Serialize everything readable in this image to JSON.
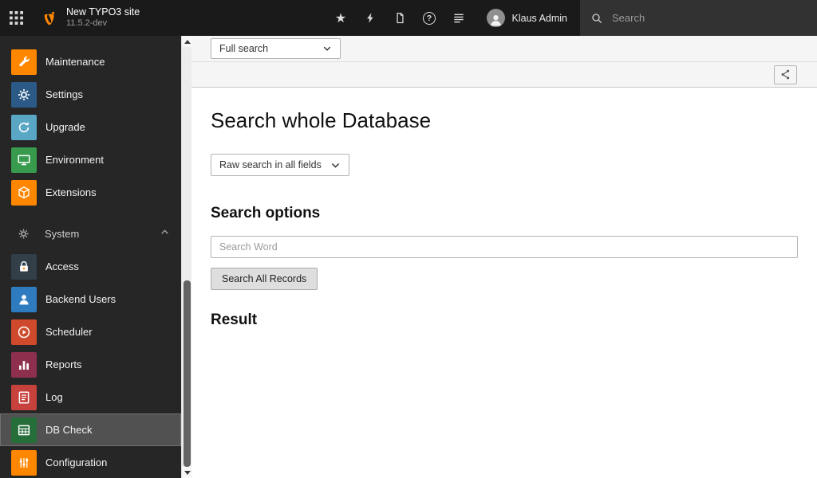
{
  "topbar": {
    "site_title": "New TYPO3 site",
    "site_version": "11.5.2-dev",
    "user_name": "Klaus Admin",
    "search_placeholder": "Search",
    "help_glyph": "?",
    "star_glyph": "★"
  },
  "sidebar": {
    "system_label": "System",
    "items": [
      {
        "label": "Maintenance",
        "icon": "wrench-icon",
        "color": "#ff8700"
      },
      {
        "label": "Settings",
        "icon": "gear-icon",
        "color": "#2c5a87"
      },
      {
        "label": "Upgrade",
        "icon": "refresh-icon",
        "color": "#59a6c5"
      },
      {
        "label": "Environment",
        "icon": "monitor-icon",
        "color": "#389a4c"
      },
      {
        "label": "Extensions",
        "icon": "cube-icon",
        "color": "#ff8700"
      },
      {
        "label": "Access",
        "icon": "lock-icon",
        "color": "#323e48"
      },
      {
        "label": "Backend Users",
        "icon": "user-icon",
        "color": "#2e7bc0"
      },
      {
        "label": "Scheduler",
        "icon": "play-circle-icon",
        "color": "#cf4a2c"
      },
      {
        "label": "Reports",
        "icon": "chart-icon",
        "color": "#8e2f4e"
      },
      {
        "label": "Log",
        "icon": "log-icon",
        "color": "#c8423d"
      },
      {
        "label": "DB Check",
        "icon": "table-icon",
        "color": "#256d39"
      },
      {
        "label": "Configuration",
        "icon": "sliders-icon",
        "color": "#ff8700"
      }
    ]
  },
  "docheader": {
    "function_select_value": "Full search"
  },
  "main": {
    "title": "Search whole Database",
    "mode_select_value": "Raw search in all fields",
    "options_heading": "Search options",
    "search_placeholder": "Search Word",
    "submit_label": "Search All Records",
    "result_heading": "Result"
  },
  "colors": {
    "accent": "#ff8700",
    "topbar_bg": "#1a1a1a",
    "sidebar_bg": "#262626",
    "selected_item_bg": "#515151"
  }
}
